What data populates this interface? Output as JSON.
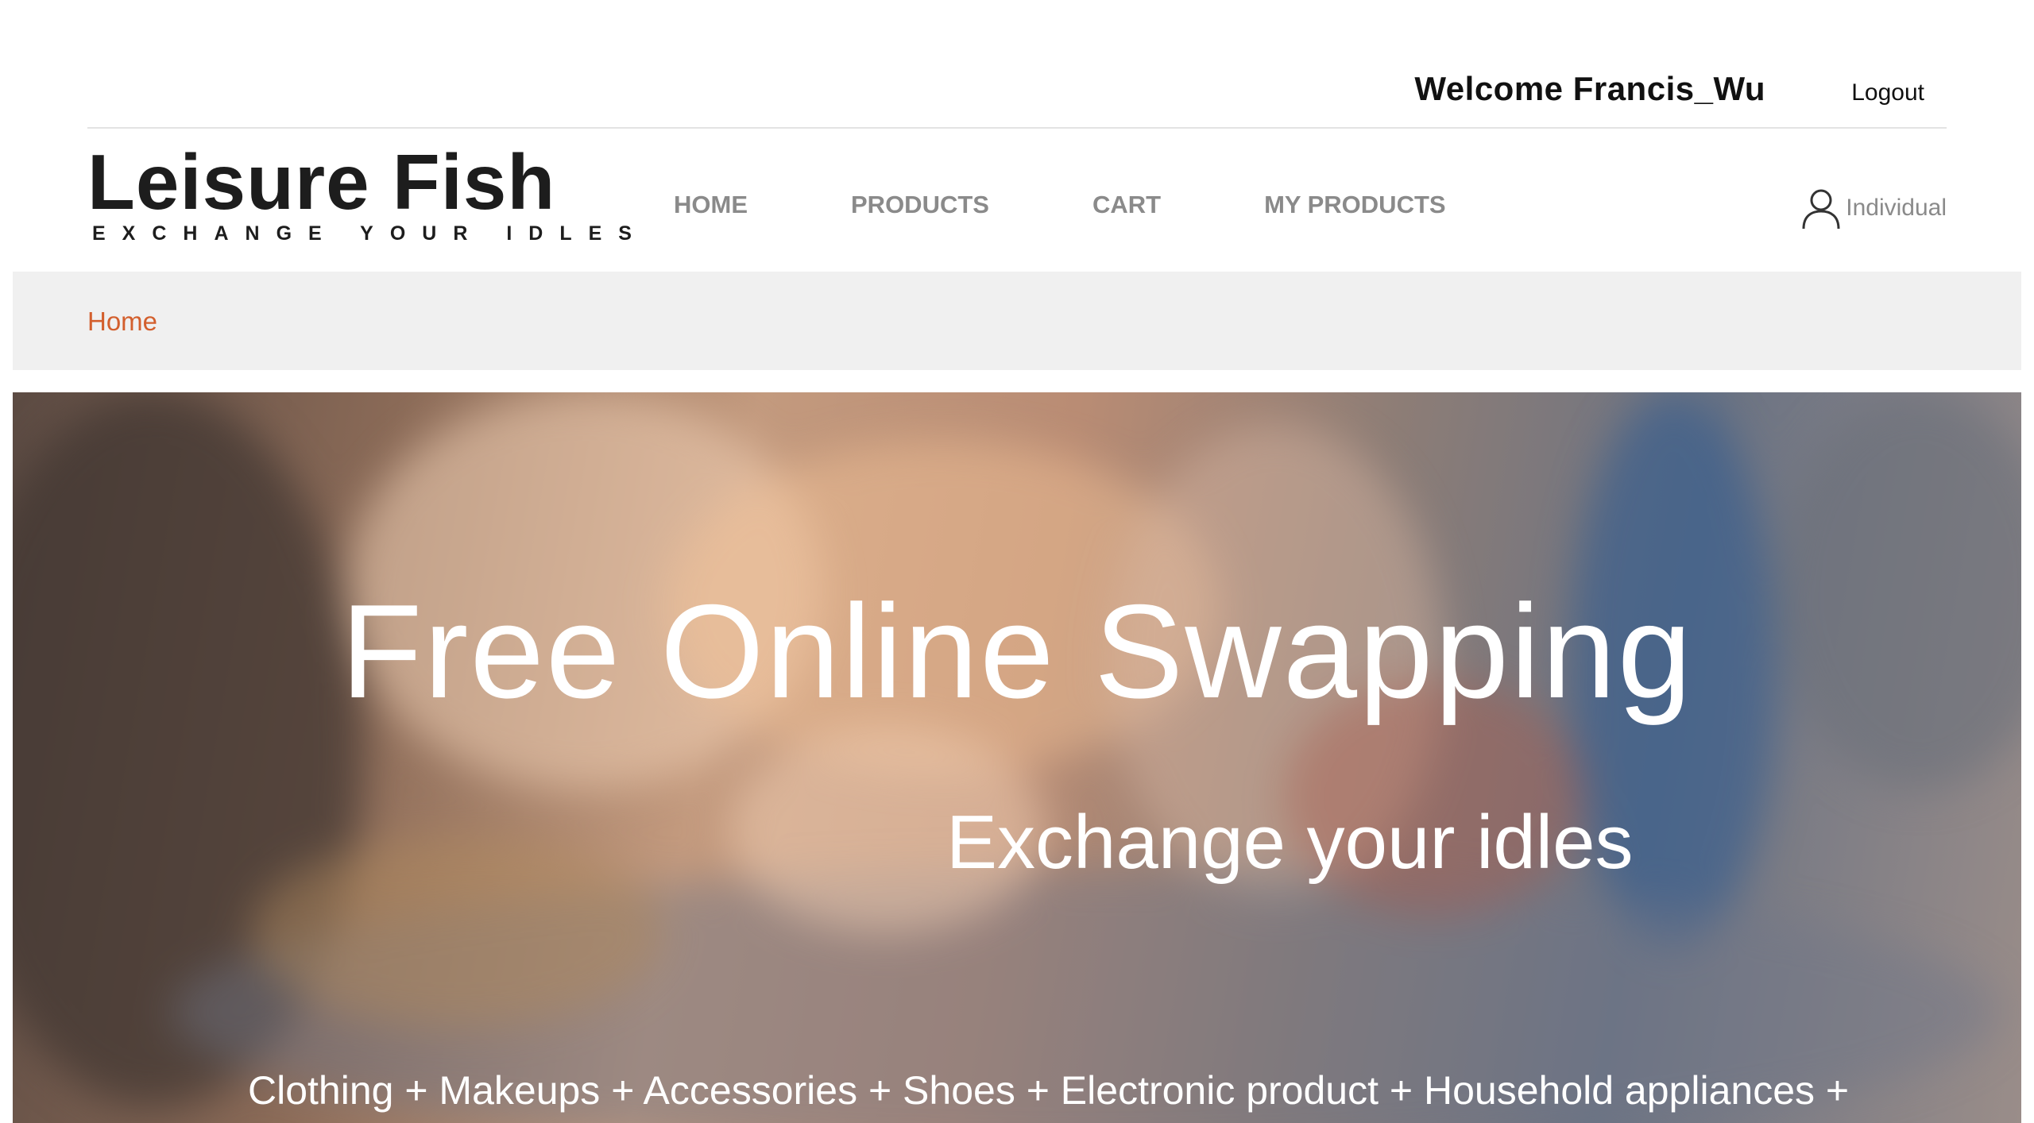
{
  "topbar": {
    "welcome_text": "Welcome Francis_Wu",
    "logout_label": "Logout"
  },
  "logo": {
    "title": "Leisure Fish",
    "tagline": "EXCHANGE YOUR IDLES"
  },
  "nav": {
    "items": [
      {
        "label": "HOME"
      },
      {
        "label": "PRODUCTS"
      },
      {
        "label": "CART"
      },
      {
        "label": "MY PRODUCTS"
      }
    ],
    "account_label": "Individual",
    "account_icon": "user-icon"
  },
  "breadcrumb": {
    "current": "Home"
  },
  "hero": {
    "title": "Free Online Swapping",
    "subtitle": "Exchange your idles",
    "categories": "Clothing + Makeups + Accessories + Shoes + Electronic product + Household appliances +"
  },
  "colors": {
    "breadcrumb_link": "#d35f2d",
    "nav_text": "#8a8a8a",
    "breadcrumb_bg": "#f0f0f0"
  }
}
